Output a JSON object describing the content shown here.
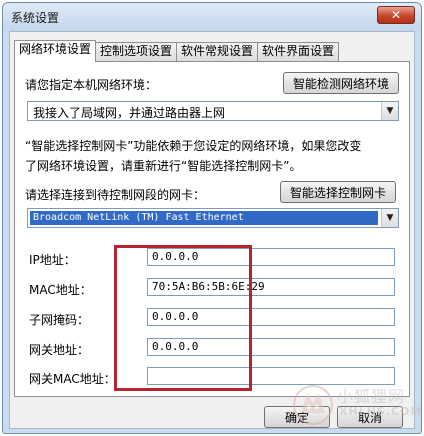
{
  "window": {
    "title": "系统设置",
    "close_glyph": "✕"
  },
  "tabs": [
    {
      "label": "网络环境设置",
      "active": true
    },
    {
      "label": "控制选项设置",
      "active": false
    },
    {
      "label": "软件常规设置",
      "active": false
    },
    {
      "label": "软件界面设置",
      "active": false
    }
  ],
  "network": {
    "env_prompt": "请您指定本机网络环境：",
    "detect_button": "智能检测网络环境",
    "env_selected": "我接入了局域网，并通过路由器上网",
    "note_line1": "“智能选择控制网卡”功能依赖于您设定的网络环境，如果您改变",
    "note_line2": "了网络环境设置，请重新进行“智能选择控制网卡”。",
    "nic_prompt": "请选择连接到待控制网段的网卡：",
    "nic_button": "智能选择控制网卡",
    "nic_selected": "Broadcom NetLink (TM) Fast Ethernet"
  },
  "fields": [
    {
      "label": "IP地址：",
      "value": "0.0.0.0"
    },
    {
      "label": "MAC地址：",
      "value": "70:5A:B6:5B:6E:29"
    },
    {
      "label": "子网掩码：",
      "value": "0.0.0.0"
    },
    {
      "label": "网关地址：",
      "value": "0.0.0.0"
    },
    {
      "label": "网关MAC地址：",
      "value": ""
    }
  ],
  "footer": {
    "ok": "确定",
    "cancel": "取消"
  },
  "watermark": {
    "cn": "小狐狸网",
    "en": "XHLHS.COM"
  },
  "colors": {
    "highlight_box": "#b52530",
    "selection": "#3169c6",
    "frame": "#c9dbee"
  }
}
